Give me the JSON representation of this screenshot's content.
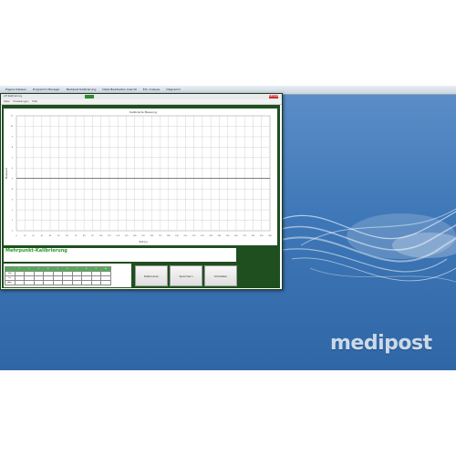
{
  "taskbar": {
    "items": [
      "Eigene Dateien",
      "Programm Manager",
      "Medipost Kalibrierung",
      "Datei  Bearbeiten  Ansicht",
      "Ext. Analyse",
      "Diagramm"
    ]
  },
  "window": {
    "title": "AIT Kalibrierung",
    "close_label": "BEENDEN",
    "menu": [
      "Datei",
      "Einstellungen",
      "Hilfe"
    ]
  },
  "chart_data": {
    "type": "line",
    "title": "Kalibrierte Messung",
    "xlabel": "Zeit [s]",
    "ylabel": "Messwert",
    "x_ticks": [
      "0",
      "10",
      "20",
      "30",
      "40",
      "50",
      "60",
      "70",
      "80",
      "90",
      "100",
      "110",
      "120",
      "130",
      "140",
      "150",
      "160",
      "170",
      "180",
      "190",
      "200",
      "210",
      "220",
      "230",
      "240",
      "250",
      "260",
      "270",
      "280",
      "290",
      "300"
    ],
    "y_ticks": [
      "11",
      "10",
      "9",
      "8",
      "7",
      "6",
      "5",
      "4",
      "3",
      "2",
      "1",
      "0"
    ],
    "ylim": [
      0,
      11
    ],
    "series": [],
    "grid": true,
    "reference_line": 5
  },
  "calibration": {
    "title": "Mehrpunkt-Kalibrierung",
    "header": [
      "",
      "1",
      "2",
      "3",
      "4",
      "5",
      "6",
      "7",
      "8",
      "9",
      "10"
    ],
    "rows": [
      [
        "Soll",
        "",
        "",
        "",
        "",
        "",
        "",
        "",
        "",
        "",
        ""
      ],
      [
        "Ist",
        "",
        "",
        "",
        "",
        "",
        "",
        "",
        "",
        "",
        ""
      ],
      [
        "Abw.",
        "",
        "",
        "",
        "",
        "",
        "",
        "",
        "",
        "",
        ""
      ]
    ]
  },
  "buttons": {
    "start_label": "Kalibrieren",
    "save_label": "Speichern",
    "close_label": "Schließen"
  },
  "brand": {
    "logo_text": "medipost"
  },
  "colors": {
    "accent_green": "#2e8b2e",
    "frame_green": "#1f4f1f",
    "desktop_blue": "#3f78b8"
  }
}
